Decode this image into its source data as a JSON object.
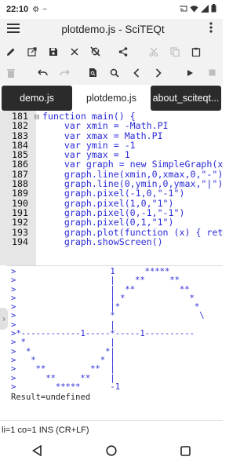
{
  "status_bar": {
    "time": "22:10",
    "icons": [
      "gear-icon",
      "minus-icon",
      "cast-icon",
      "wifi-icon",
      "signal-icon",
      "battery-icon"
    ]
  },
  "app_bar": {
    "title": "plotdemo.js - SciTEQt",
    "menu_icon": "hamburger-icon",
    "more_icon": "overflow-menu-icon"
  },
  "toolbar1": [
    {
      "name": "pencil-icon",
      "enabled": true
    },
    {
      "name": "open-external-icon",
      "enabled": true
    },
    {
      "name": "save-icon",
      "enabled": true
    },
    {
      "name": "close-icon",
      "enabled": true
    },
    {
      "name": "no-sync-icon",
      "enabled": true
    },
    {
      "name": "share-icon",
      "enabled": true
    },
    {
      "name": "cut-icon",
      "enabled": false
    },
    {
      "name": "copy-icon",
      "enabled": false
    },
    {
      "name": "paste-icon",
      "enabled": true
    }
  ],
  "toolbar2": [
    {
      "name": "delete-icon",
      "enabled": false
    },
    {
      "name": "undo-icon",
      "enabled": true
    },
    {
      "name": "redo-icon",
      "enabled": false
    },
    {
      "name": "find-in-file-icon",
      "enabled": true
    },
    {
      "name": "search-icon",
      "enabled": true
    },
    {
      "name": "previous-icon",
      "enabled": true
    },
    {
      "name": "next-icon",
      "enabled": true
    },
    {
      "name": "run-icon",
      "enabled": true
    },
    {
      "name": "stop-icon",
      "enabled": false
    }
  ],
  "tabs": [
    "demo.js",
    "plotdemo.js",
    "about_sciteqt..."
  ],
  "active_tab": 1,
  "editor": {
    "line_numbers": [
      "181",
      "182",
      "183",
      "184",
      "185",
      "186",
      "187",
      "188",
      "189",
      "190",
      "191",
      "192",
      "193",
      "194"
    ],
    "lines": [
      "function main() {",
      "    var xmin = -Math.PI",
      "    var xmax = Math.PI",
      "    var ymin = -1",
      "    var ymax = 1",
      "    var graph = new SimpleGraph(xm",
      "    graph.line(xmin,0,xmax,0,\"-\")",
      "    graph.line(0,ymin,0,ymax,\"|\")",
      "    graph.pixel(-1,0,\"-1\")",
      "    graph.pixel(1,0,\"1\")",
      "    graph.pixel(0,-1,\"-1\")",
      "    graph.pixel(0,1,\"1\")",
      "    graph.plot(function (x) { retu",
      "    graph.showScreen()"
    ]
  },
  "output": {
    "plot_lines": [
      ">                   1      *****",
      ">                   |    **     **",
      ">                   |  **         **",
      ">                   | *             *",
      ">                   |*               *",
      ">                   *                 \\",
      ">                   |",
      ">*------------1-----*-----1----------",
      "> *                 |",
      ">  *               *|",
      ">   *             * |",
      ">    **         **  |",
      ">      **     **    |",
      ">        *****      -1"
    ],
    "result": "Result=undefined"
  },
  "command_line": "li=1 co=1 INS (CR+LF)",
  "nav_bar": [
    "back-icon",
    "home-icon",
    "recents-icon"
  ]
}
